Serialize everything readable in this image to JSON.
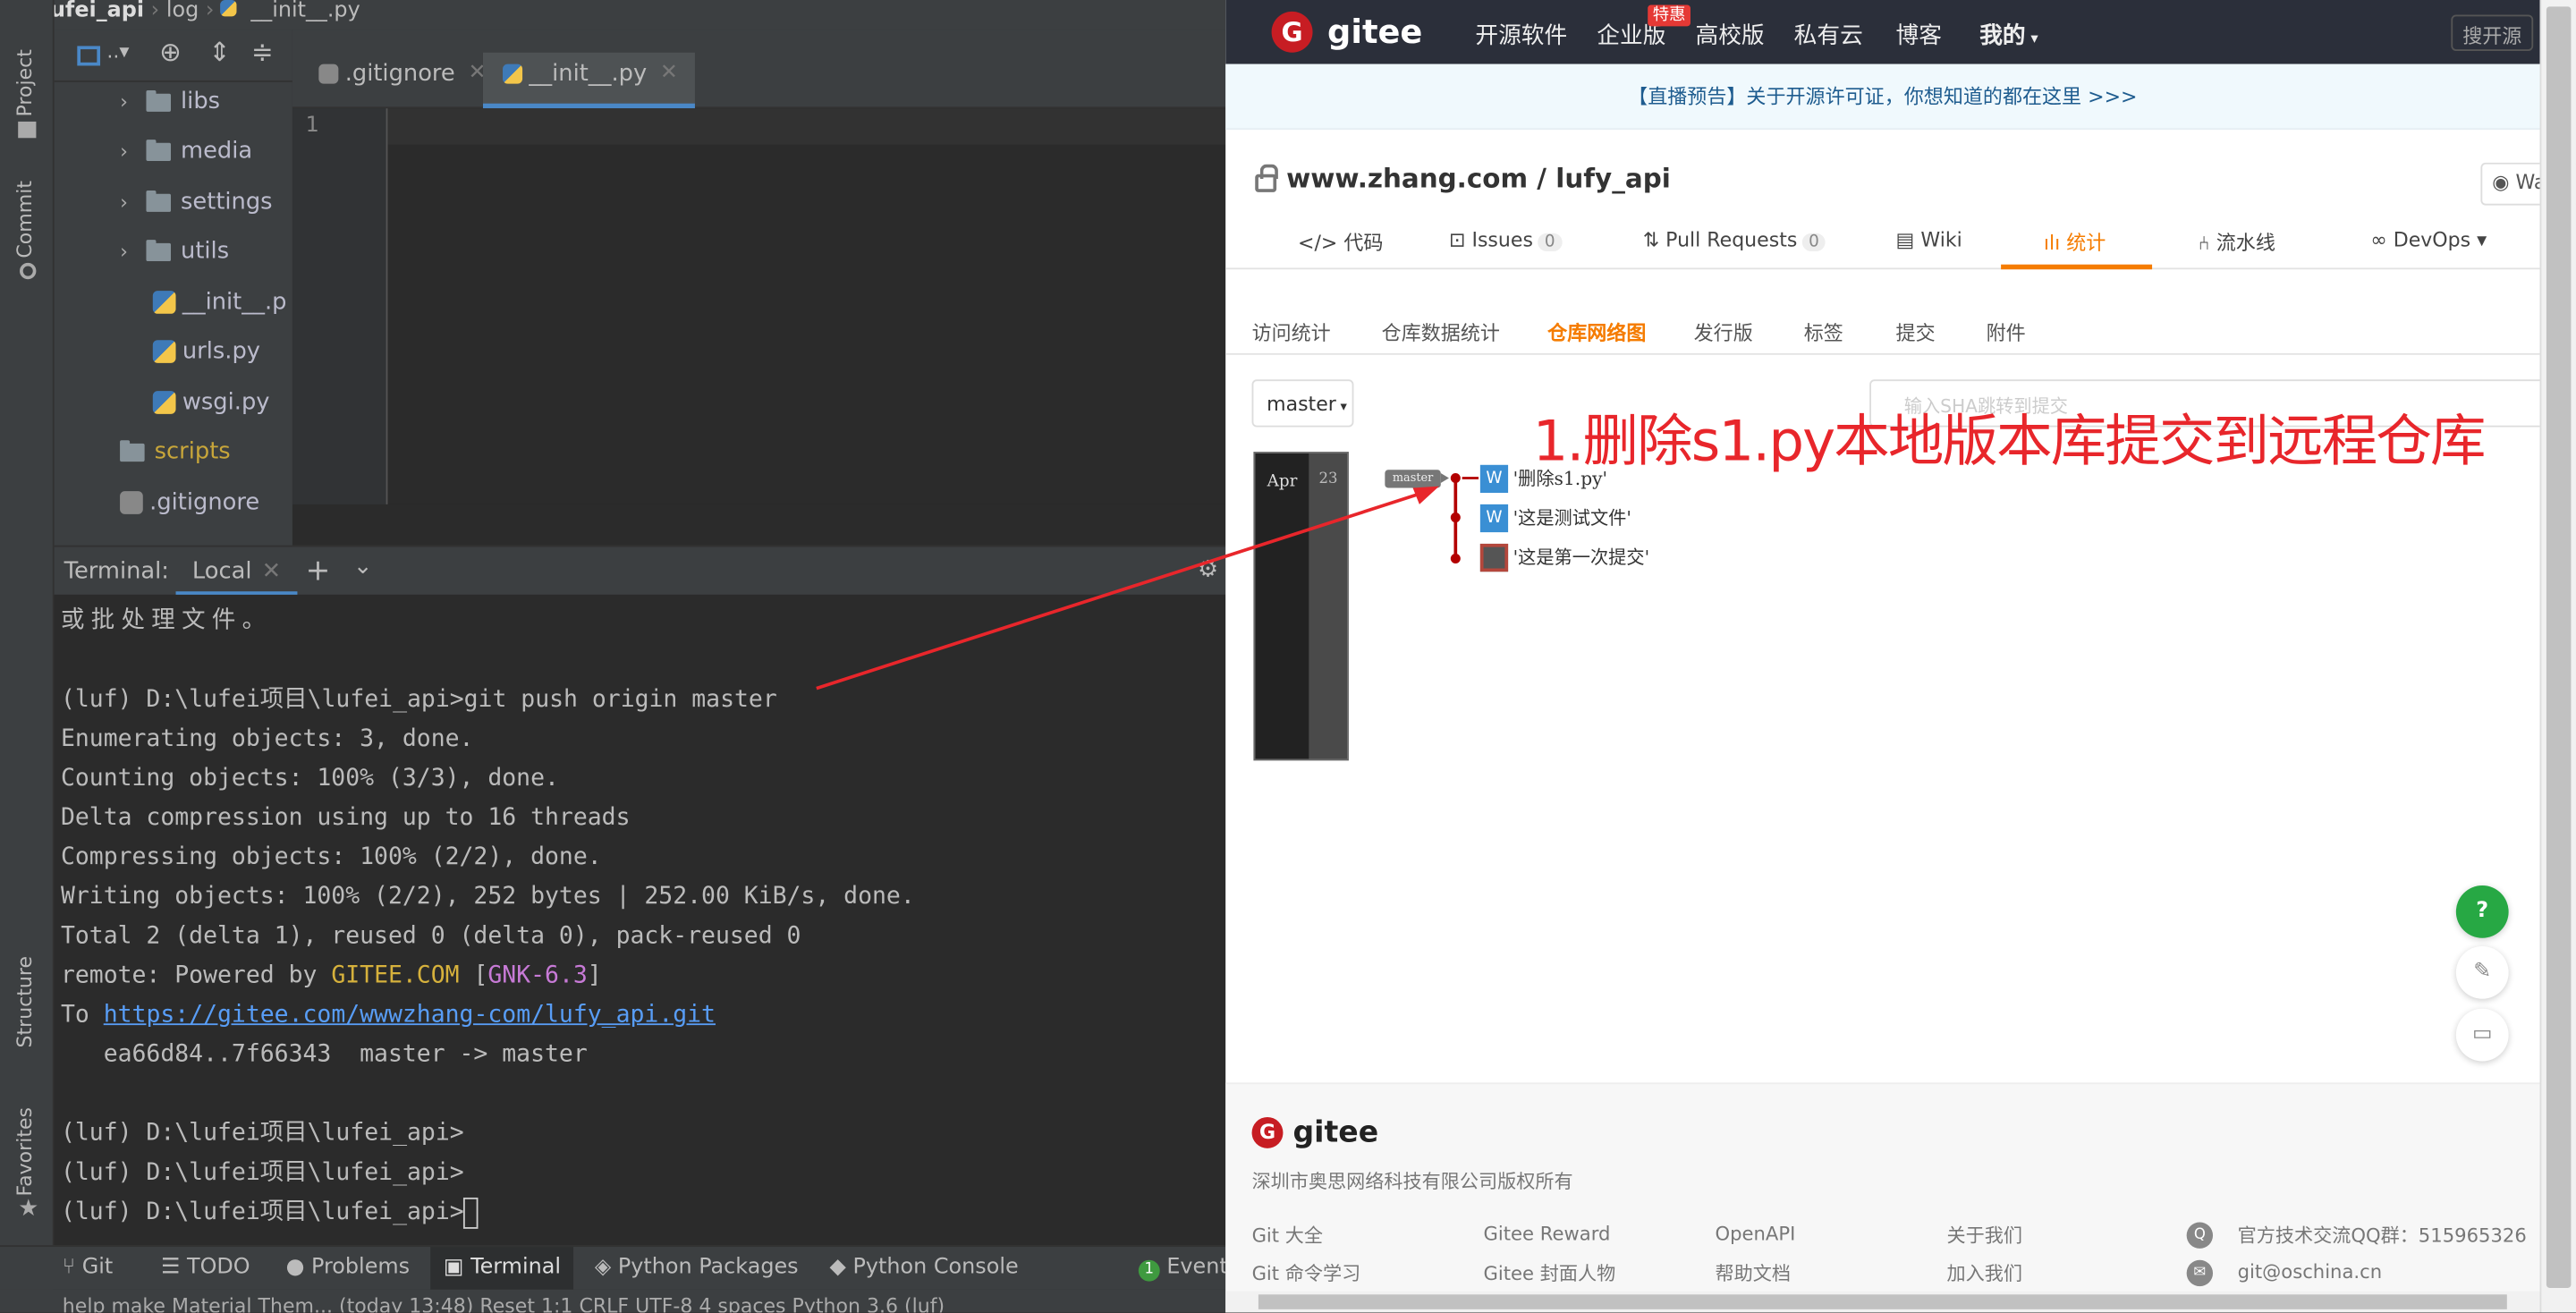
{
  "ide": {
    "breadcrumb": [
      "lufei_api",
      "log",
      "__init__.py"
    ],
    "side_tabs": [
      "Project",
      "Commit",
      "Structure",
      "Favorites"
    ],
    "tree": [
      {
        "label": "libs",
        "type": "folder",
        "expandable": true
      },
      {
        "label": "media",
        "type": "folder",
        "expandable": true
      },
      {
        "label": "settings",
        "type": "folder",
        "expandable": true
      },
      {
        "label": "utils",
        "type": "folder",
        "expandable": true
      },
      {
        "label": "__init__.p",
        "type": "python"
      },
      {
        "label": "urls.py",
        "type": "python"
      },
      {
        "label": "wsgi.py",
        "type": "python"
      },
      {
        "label": "scripts",
        "type": "folder-yellow"
      },
      {
        "label": ".gitignore",
        "type": "file"
      }
    ],
    "editor_tabs": [
      {
        "label": ".gitignore",
        "active": false
      },
      {
        "label": "__init__.py",
        "active": true
      }
    ],
    "line_number": "1",
    "terminal_title": "Terminal:",
    "terminal_tab": "Local",
    "terminal_lines": [
      "或批处理文件。",
      "",
      "(luf) D:\\lufei项目\\lufei_api>git push origin master",
      "Enumerating objects: 3, done.",
      "Counting objects: 100% (3/3), done.",
      "Delta compression using up to 16 threads",
      "Compressing objects: 100% (2/2), done.",
      "Writing objects: 100% (2/2), 252 bytes | 252.00 KiB/s, done.",
      "Total 2 (delta 1), reused 0 (delta 0), pack-reused 0"
    ],
    "remote_prefix": "remote: Powered by ",
    "remote_gitee": "GITEE.COM",
    "remote_open": " [",
    "remote_gnk": "GNK-6.3",
    "remote_close": "]",
    "to_prefix": "To ",
    "to_url": "https://gitee.com/wwwzhang-com/lufy_api.git",
    "terminal_tail": [
      "   ea66d84..7f66343  master -> master",
      "",
      "(luf) D:\\lufei项目\\lufei_api>",
      "(luf) D:\\lufei项目\\lufei_api>",
      "(luf) D:\\lufei项目\\lufei_api>"
    ],
    "bottom_tabs": [
      "Git",
      "TODO",
      "Problems",
      "Terminal",
      "Python Packages",
      "Python Console"
    ],
    "event_count": "1",
    "event_label": "Event",
    "status_text": "help make Material Them... (today 13:48)      Reset   1:1   CRLF   UTF-8   4 spaces   Python 3.6 (luf)"
  },
  "web": {
    "logo": "gitee",
    "nav": [
      "开源软件",
      "企业版",
      "高校版",
      "私有云",
      "博客",
      "我的"
    ],
    "hot_badge": "特惠",
    "search_placeholder": "搜开源",
    "announcement": "【直播预告】关于开源许可证，你想知道的都在这里 >>>",
    "repo_path": "www.zhang.com / lufy_api",
    "watch": "Wa",
    "tabs": [
      {
        "label": "代码",
        "icon": "</>"
      },
      {
        "label": "Issues",
        "count": "0"
      },
      {
        "label": "Pull Requests",
        "count": "0"
      },
      {
        "label": "Wiki"
      },
      {
        "label": "统计"
      },
      {
        "label": "流水线"
      },
      {
        "label": "DevOps"
      }
    ],
    "subtabs": [
      "访问统计",
      "仓库数据统计",
      "仓库网络图",
      "发行版",
      "标签",
      "提交",
      "附件"
    ],
    "branch": "master",
    "sha_placeholder": "输入SHA跳转到提交",
    "graph": {
      "month": "Apr",
      "day": "23",
      "branch_label": "master",
      "commits": [
        {
          "message": "'删除s1.py'",
          "avatar": "W"
        },
        {
          "message": "'这是测试文件'",
          "avatar": "W"
        },
        {
          "message": "'这是第一次提交'",
          "avatar": ""
        }
      ]
    },
    "annotation": "1.删除s1.py本地版本库提交到远程仓库",
    "footer": {
      "logo": "gitee",
      "company": "深圳市奥思网络科技有限公司版权所有",
      "links": [
        [
          "Git 大全",
          "Git 命令学习"
        ],
        [
          "Gitee Reward",
          "Gitee 封面人物"
        ],
        [
          "OpenAPI",
          "帮助文档"
        ],
        [
          "关于我们",
          "加入我们"
        ]
      ],
      "qq": "官方技术交流QQ群：515965326",
      "email": "git@oschina.cn"
    },
    "colors": {
      "accent": "#f57c00",
      "brand": "#c71d23",
      "annotation": "#e8262b",
      "help_button": "#27a844"
    }
  }
}
